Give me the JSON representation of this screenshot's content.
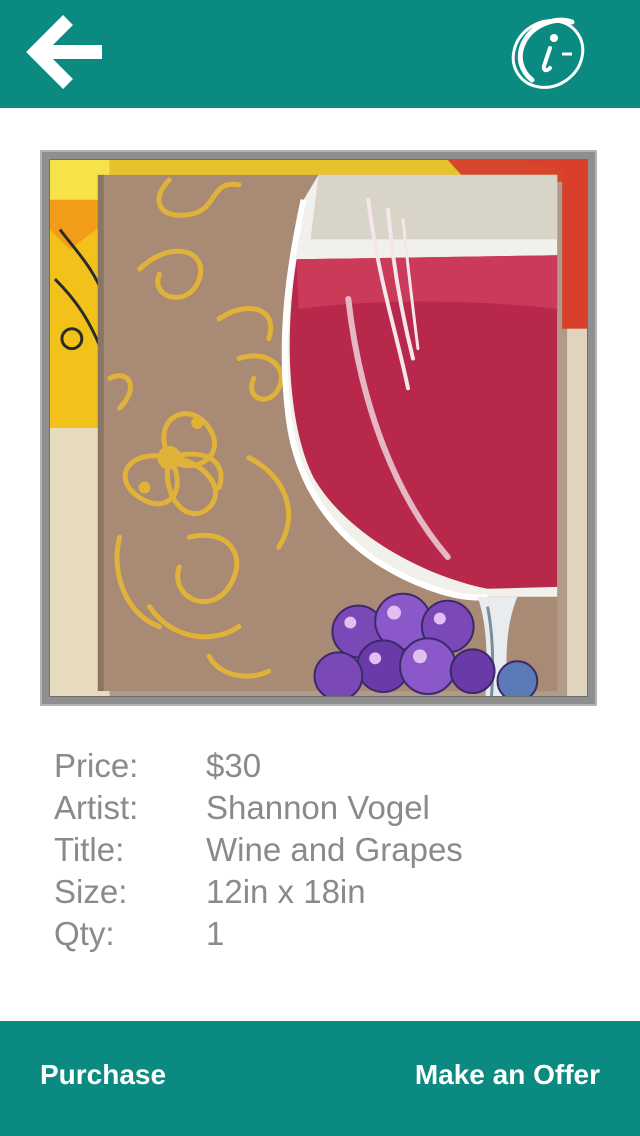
{
  "header": {
    "back_icon": "arrow-left-icon",
    "info_icon": "info-circle-icon",
    "bar_color": "#0a8a80"
  },
  "artwork": {
    "image_alt": "Wine and Grapes painting",
    "details": [
      {
        "label": "Price:",
        "value": "$30"
      },
      {
        "label": "Artist:",
        "value": "Shannon Vogel"
      },
      {
        "label": "Title:",
        "value": "Wine and Grapes"
      },
      {
        "label": "Size:",
        "value": "12in x 18in"
      },
      {
        "label": "Qty:",
        "value": "1"
      }
    ]
  },
  "footer": {
    "purchase_label": "Purchase",
    "offer_label": "Make an Offer"
  }
}
